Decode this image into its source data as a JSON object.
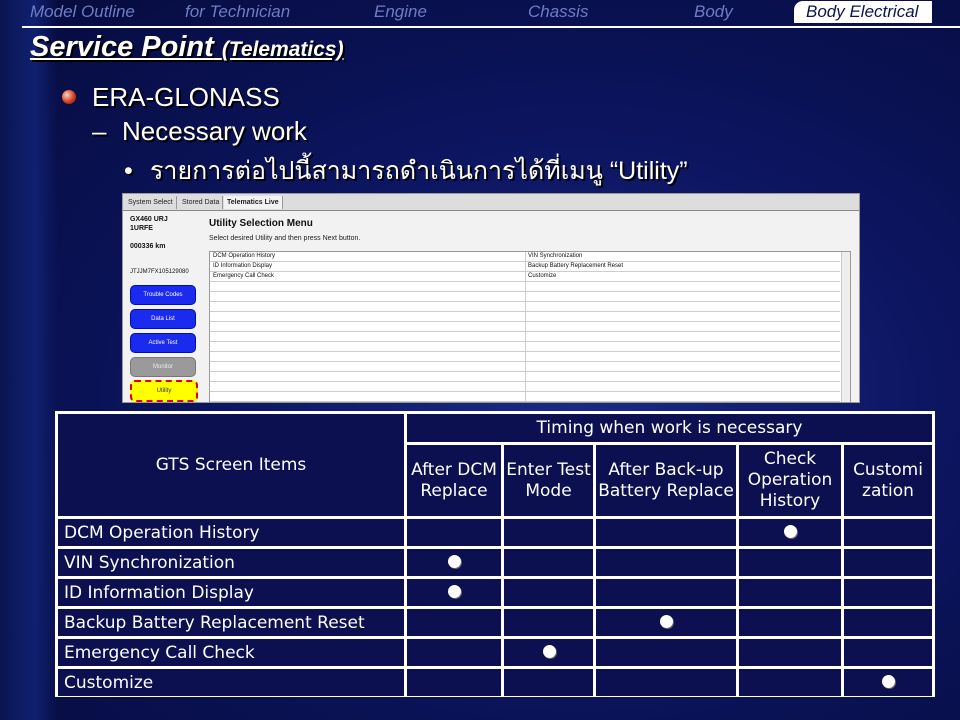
{
  "nav": {
    "items": [
      "Model Outline",
      "for Technician",
      "Engine",
      "Chassis",
      "Body",
      "Body Electrical"
    ],
    "active_index": 5
  },
  "title": {
    "main": "Service Point",
    "sub": "(Telematics)"
  },
  "content": {
    "level1": "ERA-GLONASS",
    "level2_dash": "–",
    "level2": "Necessary work",
    "level3_bullet": "•",
    "level3": "รายการต่อไปนี้สามารถดำเนินการได้ที่เมนู “Utility”"
  },
  "screenshot": {
    "tabs": [
      "System Select",
      "Stored Data",
      "Telematics Live"
    ],
    "active_tab": 2,
    "vehicle": {
      "model": "GX460 URJ",
      "engine": "1URFE",
      "odometer": "000336 km",
      "vin": "JTJJM7FX105129080"
    },
    "buttons": [
      "Trouble Codes",
      "Data List",
      "Active Test",
      "Monitor",
      "Utility"
    ],
    "heading": "Utility Selection Menu",
    "subheading": "Select desired Utility and then press Next button.",
    "grid_rows": [
      [
        "DCM Operation History",
        "VIN Synchronization"
      ],
      [
        "ID Information Display",
        "Backup Battery Replacement Reset"
      ],
      [
        "Emergency Call Check",
        "Customize"
      ]
    ]
  },
  "table": {
    "corner_header": "GTS Screen Items",
    "group_header": "Timing when work is necessary",
    "columns": [
      "After DCM Replace",
      "Enter Test Mode",
      "After Back-up Battery Replace",
      "Check Operation History",
      "Customi zation"
    ],
    "rows": [
      {
        "item": "DCM Operation History",
        "marks": [
          false,
          false,
          false,
          true,
          false
        ]
      },
      {
        "item": "VIN Synchronization",
        "marks": [
          true,
          false,
          false,
          false,
          false
        ]
      },
      {
        "item": "ID Information Display",
        "marks": [
          true,
          false,
          false,
          false,
          false
        ]
      },
      {
        "item": "Backup Battery Replacement Reset",
        "marks": [
          false,
          false,
          true,
          false,
          false
        ]
      },
      {
        "item": "Emergency Call Check",
        "marks": [
          false,
          true,
          false,
          false,
          false
        ]
      },
      {
        "item": "Customize",
        "marks": [
          false,
          false,
          false,
          false,
          true
        ]
      }
    ]
  }
}
